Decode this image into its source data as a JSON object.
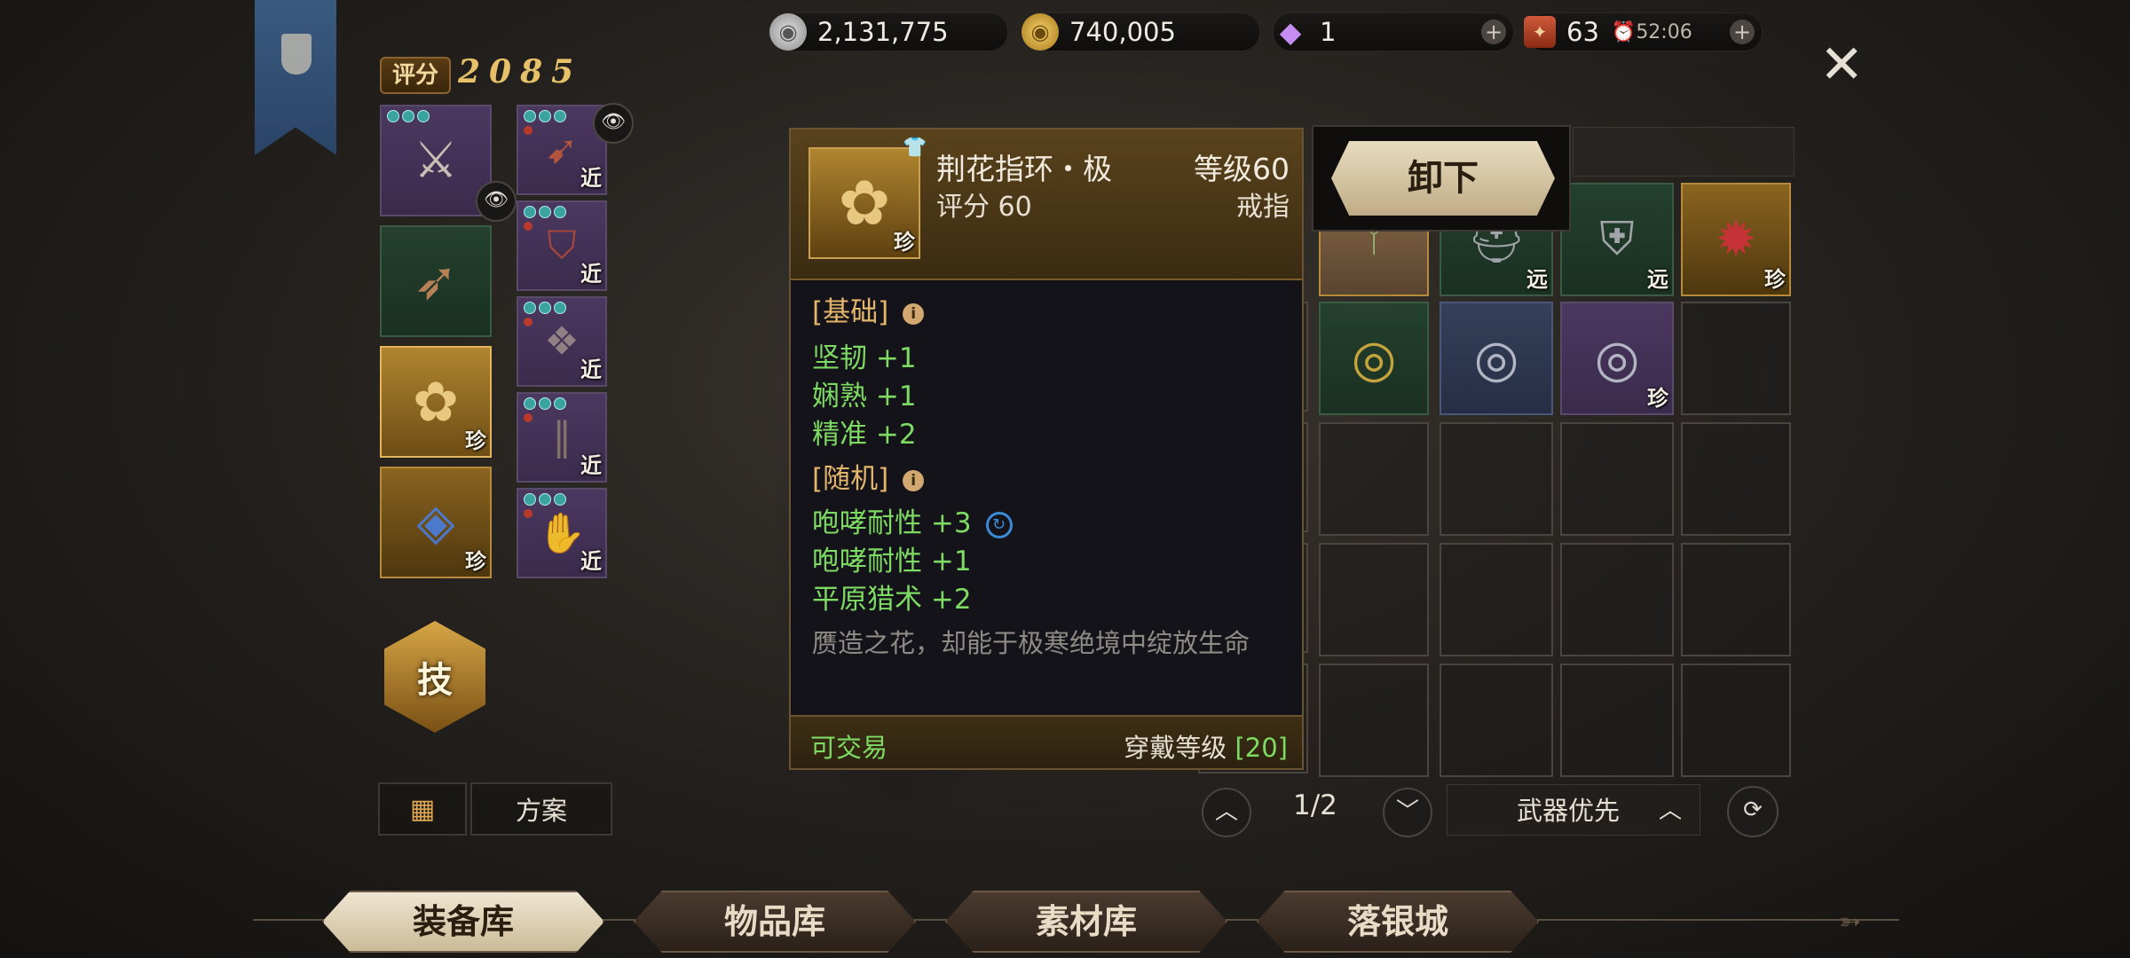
{
  "currencies": {
    "silver": "2,131,775",
    "gold": "740,005",
    "diamond": "1",
    "stamina": "63",
    "stamina_timer": "52:06"
  },
  "score": {
    "label": "评分",
    "value": "2085"
  },
  "slot_tags": {
    "rare": "珍",
    "melee": "近",
    "ranged": "远"
  },
  "tooltip": {
    "name": "荆花指环・极",
    "level": "等级60",
    "score": "评分 60",
    "type": "戒指",
    "tag": "珍",
    "basic_title": "[基础]",
    "basic_stats": [
      "坚韧 +1",
      "娴熟 +1",
      "精准 +2"
    ],
    "random_title": "[随机]",
    "random_stats": [
      "咆哮耐性 +3",
      "咆哮耐性 +1",
      "平原猎术 +2"
    ],
    "description": "赝造之花，却能于极寒绝境中绽放生命",
    "tradable": "可交易",
    "wear_level_label": "穿戴等级",
    "wear_level": "[20]"
  },
  "unequip_button": "卸下",
  "skill_button": "技",
  "plan_button": "方案",
  "pager": {
    "text": "1/2"
  },
  "sort_option": "武器优先",
  "tabs": [
    "装备库",
    "物品库",
    "素材库",
    "落银城"
  ],
  "colors": {
    "stat_green": "#7dda62",
    "section_orange": "#e3b66b",
    "rare_gold": "#e4b55a",
    "purple_slot": "#4b3860"
  }
}
